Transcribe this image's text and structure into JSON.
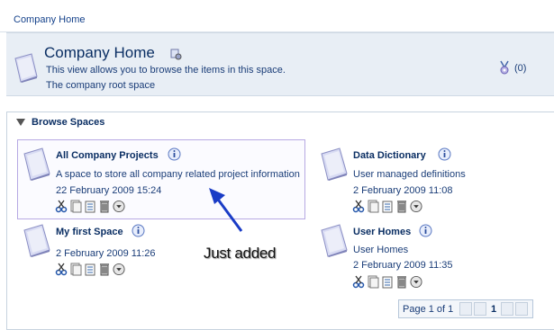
{
  "breadcrumb": {
    "items": [
      "Company Home"
    ]
  },
  "header": {
    "title": "Company Home",
    "subtitle": "This view allows you to browse the items in this space.",
    "description": "The company root space",
    "count": "(0)",
    "icons": {
      "space": "space-folder-icon",
      "details": "space-details-icon",
      "rss": "rss-feed-icon"
    }
  },
  "browse": {
    "heading": "Browse Spaces",
    "spaces": [
      {
        "title": "All Company Projects",
        "description": "A space to store all company related project information",
        "date": "22 February 2009 15:24"
      },
      {
        "title": "Data Dictionary",
        "description": "User managed definitions",
        "date": "2 February 2009 11:08"
      },
      {
        "title": "My first Space",
        "description": "",
        "date": "2 February 2009 11:26"
      },
      {
        "title": "User Homes",
        "description": "User Homes",
        "date": "2 February 2009 11:35"
      }
    ],
    "action_icons": [
      "cut-icon",
      "copy-icon",
      "paste-icon",
      "delete-icon",
      "more-actions-icon"
    ]
  },
  "pager": {
    "label": "Page 1 of 1",
    "current": "1"
  },
  "annotation": {
    "text": "Just added"
  },
  "colors": {
    "accent": "#0a2e63",
    "header_bg": "#e8eef5",
    "highlight_border": "#b7a9e3",
    "arrow": "#1a3cc6"
  }
}
